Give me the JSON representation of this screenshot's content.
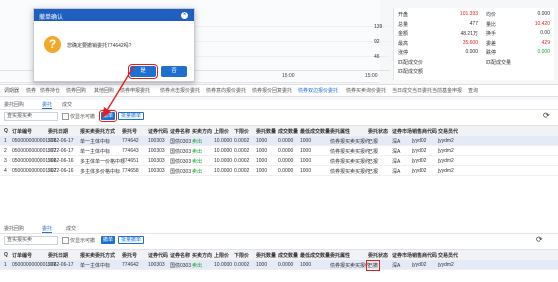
{
  "top": {
    "chart_numbers": [
      "139",
      "92",
      "46"
    ],
    "times": [
      "15:00",
      "15:00"
    ],
    "quote": {
      "rows": [
        {
          "l1": "开盘",
          "v1": "101.393",
          "c1": "red",
          "l2": "均价",
          "v2": "0.000",
          "c2": ""
        },
        {
          "l1": "总量",
          "v1": "477",
          "c1": "",
          "l2": "量比",
          "v2": "10.420",
          "c2": "red"
        },
        {
          "l1": "金额",
          "v1": "48.21万",
          "c1": "",
          "l2": "换手",
          "v2": "0.00",
          "c2": ""
        },
        {
          "l1": "最高",
          "v1": "35.600",
          "c1": "red",
          "l2": "委差",
          "v2": "429",
          "c2": "red"
        },
        {
          "l1": "涨停",
          "v1": "0.000",
          "c1": "",
          "l2": "跌停",
          "v2": "0.000",
          "c2": "green"
        },
        {
          "l1": "匹配成交价",
          "v1": "",
          "c1": "",
          "l2": "匹配成交量",
          "v2": "",
          "c2": ""
        },
        {
          "l1": "匹配成交额",
          "v1": "",
          "c1": "",
          "l2": "",
          "v2": "",
          "c2": ""
        }
      ]
    }
  },
  "nav_tabs": [
    "调期器",
    "债券",
    "债券持仓",
    "债券回购",
    "其他回购",
    "债券申报委托",
    "债券点击报价委托",
    "债券意向报价委托",
    "债券报价回复委托",
    "债券双边报价委托",
    "债券买卖询价委托",
    "当日成交",
    "当日委托",
    "当前基金申报",
    "查询"
  ],
  "dialog": {
    "title": "撤单确认",
    "close_glyph": "×",
    "icon_glyph": "?",
    "message": "您确定要撤销委托774642吗?",
    "confirm": "是",
    "cancel": "否"
  },
  "panel1": {
    "sub_tabs": [
      "委托回购",
      "委托",
      "成交"
    ],
    "select": "查实报买卖",
    "checkbox_label": "仅显示可撤",
    "btn_cancel": "撤单",
    "btn_cancel_all": "批量撤单",
    "refresh_glyph": "⟳",
    "headers": [
      "Q",
      "订单编号",
      "委托日期",
      "报买卖委托方式",
      "委托号",
      "证券代码",
      "证券名称",
      "买卖方向",
      "上限价",
      "下限价",
      "委托数量",
      "成交数量",
      "最低成交数量",
      "委托属性",
      "委托状态",
      "证券市场",
      "销售商代码",
      "交易员代"
    ],
    "rows": [
      [
        "1",
        "0500000000001576",
        "2022-06-17",
        "单一主体中标",
        "774642",
        "100303",
        "国债0303",
        "卖出",
        "10.0000",
        "0.0002",
        "1000",
        "0.0000",
        "1000",
        "债券报买卖买报约",
        "已报",
        "深A",
        "jyyd02",
        "jyydm2"
      ],
      [
        "2",
        "0500000000001577",
        "2022-06-17",
        "单一主体中标",
        "774643",
        "100303",
        "国债0303",
        "卖出",
        "10.0000",
        "0.0002",
        "1000",
        "0.0000",
        "1000",
        "债券报买卖买报约",
        "已报",
        "深A",
        "jyyd02",
        "jyydm2"
      ],
      [
        "3",
        "0500000000001596",
        "2022-06-16",
        "多主体单一价格中标",
        "774651",
        "100303",
        "国债0303",
        "卖出",
        "10.0000",
        "0.0002",
        "1000",
        "0.0000",
        "1000",
        "债券报买卖买报约",
        "已报",
        "深A",
        "jyyd02",
        "jyydm2"
      ],
      [
        "4",
        "0500000000001597",
        "2022-06-16",
        "多主体多价格中标",
        "774658",
        "100303",
        "国债0303",
        "卖出",
        "10.0000",
        "0.0002",
        "1000",
        "0.0000",
        "1000",
        "债券报买卖买报约",
        "已报",
        "深A",
        "jyyd02",
        "jyydm2"
      ]
    ]
  },
  "panel2": {
    "sub_tabs": [
      "委托回购",
      "委托",
      "成交"
    ],
    "select": "查实报买卖",
    "checkbox_label": "仅显示可撤",
    "btn_cancel": "撤单",
    "btn_cancel_all": "批量撤单",
    "refresh_glyph": "⟳",
    "headers": [
      "Q",
      "订单编号",
      "委托日期",
      "报买卖委托方式",
      "委托号",
      "证券代码",
      "证券名称",
      "买卖方向",
      "上限价",
      "下限价",
      "委托数量",
      "成交数量",
      "最低成交数量",
      "委托属性",
      "委托状态",
      "证券市场",
      "销售商代码",
      "交易员代"
    ],
    "rows": [
      [
        "1",
        "0500000000001576",
        "2022-06-17",
        "单一主体中标",
        "774642",
        "100303",
        "国债0303",
        "卖出",
        "10.0000",
        "0.0002",
        "1000",
        "0.0000",
        "1000",
        "债券报买卖买报约",
        "已撤",
        "深A",
        "jyyd02",
        "jyydm2"
      ]
    ]
  },
  "colors": {
    "accent": "#1f6fd1",
    "header_blue": "#1f5fbf",
    "highlight": "#e02020",
    "sell_green": "#1a9c3a"
  }
}
